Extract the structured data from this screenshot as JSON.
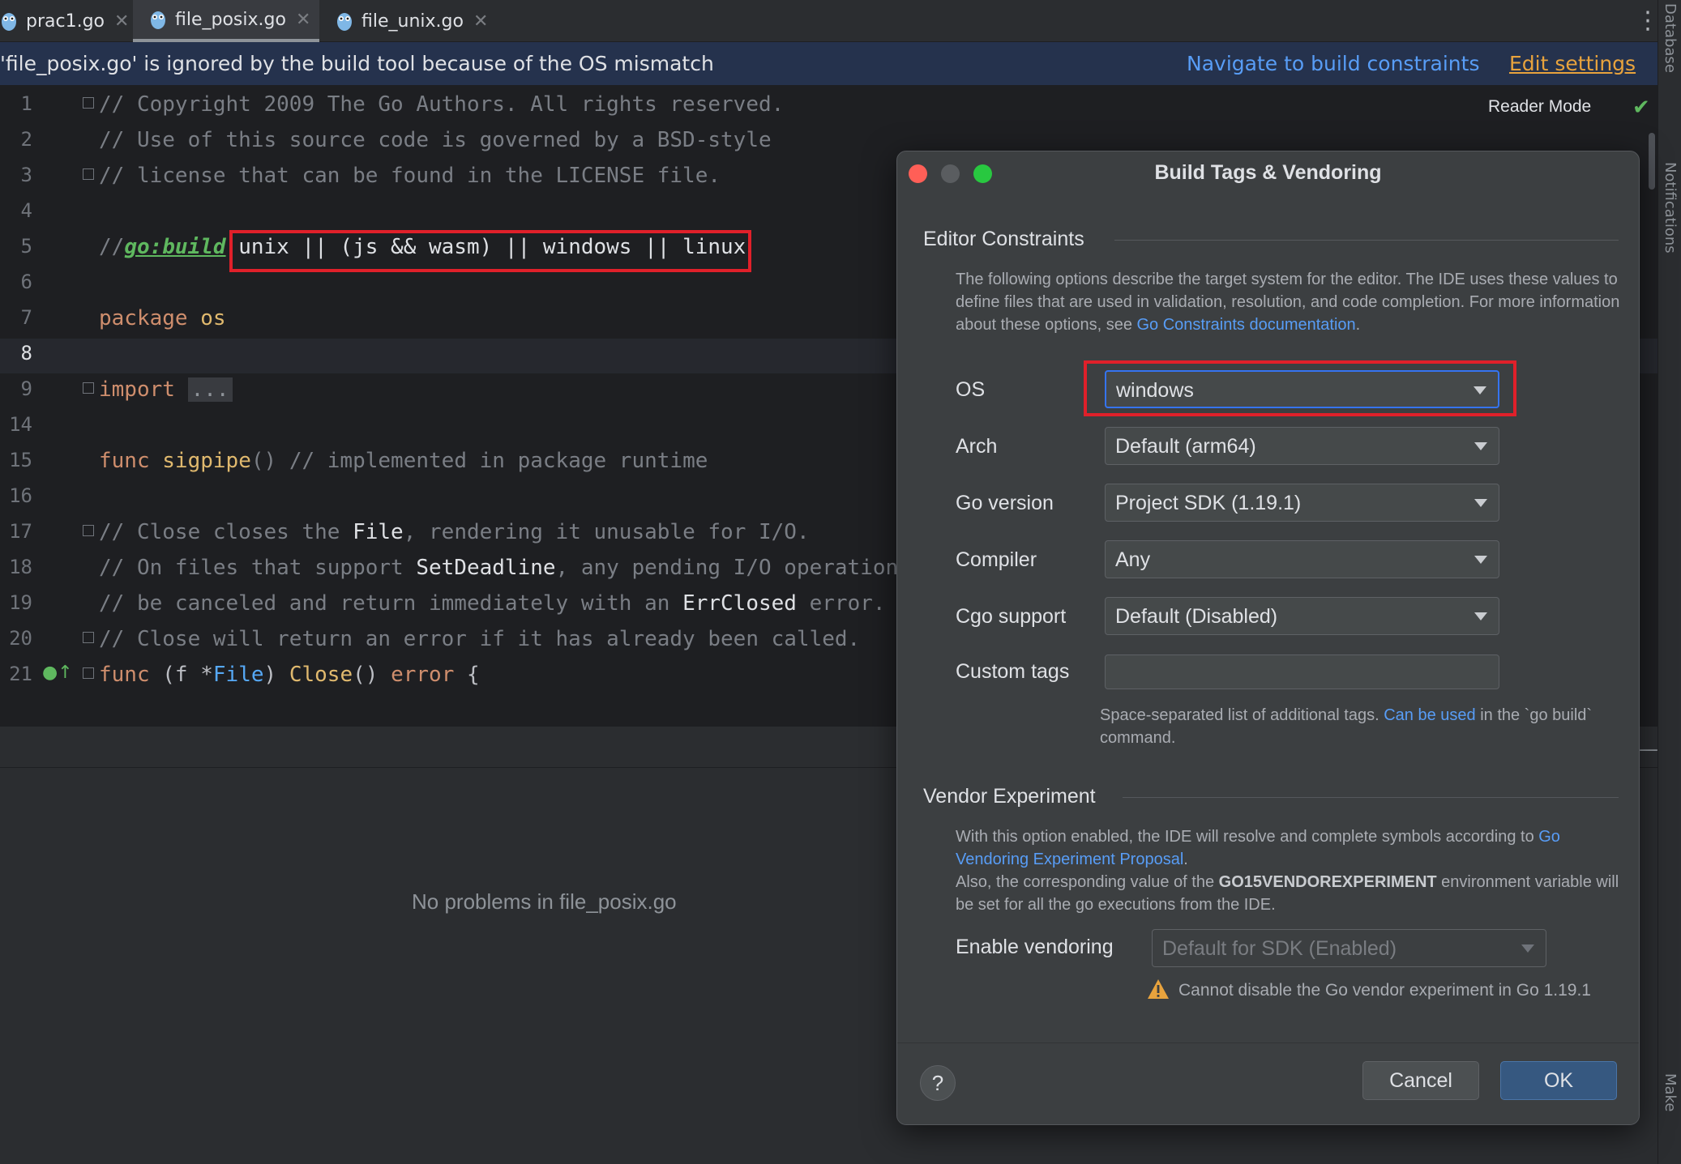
{
  "tabs": [
    {
      "label": "prac1.go",
      "active": false
    },
    {
      "label": "file_posix.go",
      "active": true
    },
    {
      "label": "file_unix.go",
      "active": false
    }
  ],
  "banner": {
    "message": "'file_posix.go' is ignored by the build tool because of the OS mismatch",
    "navigate_link": "Navigate to build constraints",
    "edit_settings_link": "Edit settings"
  },
  "editor": {
    "reader_mode": "Reader Mode",
    "line_numbers": [
      "1",
      "2",
      "3",
      "4",
      "5",
      "6",
      "7",
      "8",
      "9",
      "14",
      "15",
      "16",
      "17",
      "18",
      "19",
      "20",
      "21"
    ],
    "lines": {
      "l1": "// Copyright 2009 The Go Authors. All rights reserved.",
      "l2": "// Use of this source code is governed by a BSD-style",
      "l3": "// license that can be found in the LICENSE file.",
      "l5_prefix": "//",
      "l5_directive": "go:build",
      "l5_expr": "unix || (js && wasm) || windows || linux",
      "l7_kw": "package",
      "l7_name": "os",
      "l9_kw": "import",
      "l9_fold": "...",
      "l15_kw": "func",
      "l15_name": "sigpipe",
      "l15_rest": "() // implemented in package runtime",
      "l17_a": "// Close closes the ",
      "l17_b": "File",
      "l17_c": ", rendering it unusable for I/O.",
      "l18_a": "// On files that support ",
      "l18_b": "SetDeadline",
      "l18_c": ", any pending I/O operation",
      "l19_a": "// be canceled and return immediately with an ",
      "l19_b": "ErrClosed",
      "l19_c": " error.",
      "l20": "// Close will return an error if it has already been called.",
      "l21_kw": "func",
      "l21_a": " (f *",
      "l21_type": "File",
      "l21_b": ") ",
      "l21_name": "Close",
      "l21_c": "() ",
      "l21_kw2": "error",
      "l21_d": " {"
    }
  },
  "problems": {
    "empty_text": "No problems in file_posix.go"
  },
  "right_strip": {
    "top_label": "Database",
    "mid_label": "Notifications",
    "bottom_label": "Make"
  },
  "dialog": {
    "title": "Build Tags & Vendoring",
    "editor_constraints": {
      "heading": "Editor Constraints",
      "desc_1": "The following options describe the target system for the editor. The IDE uses these values to define files that are used in validation, resolution, and code completion. For more information about these options, see ",
      "desc_link": "Go Constraints documentation",
      "desc_2": "."
    },
    "fields": {
      "os_label": "OS",
      "os_value": "windows",
      "arch_label": "Arch",
      "arch_value": "Default (arm64)",
      "go_version_label": "Go version",
      "go_version_value": "Project SDK (1.19.1)",
      "compiler_label": "Compiler",
      "compiler_value": "Any",
      "cgo_label": "Cgo support",
      "cgo_value": "Default (Disabled)",
      "custom_tags_label": "Custom tags",
      "custom_tags_value": "",
      "custom_hint_1": "Space-separated list of additional tags. ",
      "custom_hint_link": "Can be used",
      "custom_hint_2": " in the `go build` command."
    },
    "vendor": {
      "heading": "Vendor Experiment",
      "desc_1": "With this option enabled, the IDE will resolve and complete symbols according to ",
      "desc_link": "Go Vendoring Experiment Proposal",
      "desc_2": ".",
      "desc_3": "Also, the corresponding value of the ",
      "desc_bold": "GO15VENDOREXPERIMENT",
      "desc_4": " environment variable will be set for all the go executions from the IDE.",
      "enable_label": "Enable vendoring",
      "enable_value": "Default for SDK (Enabled)",
      "warning": "Cannot disable the Go vendor experiment in Go 1.19.1"
    },
    "buttons": {
      "help": "?",
      "cancel": "Cancel",
      "ok": "OK"
    },
    "colors": {
      "accent": "#3574f0",
      "highlight_box": "#e0202a",
      "link": "#589df6",
      "warning": "#e8a33d"
    }
  }
}
